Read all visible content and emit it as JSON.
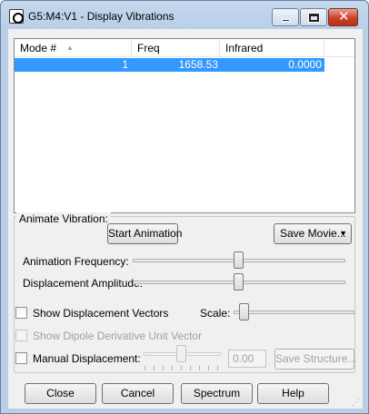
{
  "window": {
    "title": "G5:M4:V1 - Display Vibrations",
    "icons": {
      "app": "document-icon",
      "minimize": "minimize-icon",
      "maximize": "maximize-icon",
      "close": "close-icon"
    }
  },
  "modes_table": {
    "columns": [
      "Mode #",
      "Freq",
      "Infrared"
    ],
    "sort_indicator": "sort-ascending-icon",
    "rows": [
      {
        "mode": "1",
        "freq": "1658.53",
        "infrared": "0.0000",
        "selected": true
      }
    ]
  },
  "animate": {
    "group_label": "Animate Vibration:",
    "start_label": "Start Animation",
    "save_movie_label": "Save Movie...",
    "frequency_label": "Animation Frequency:",
    "amplitude_label": "Displacement Amplitude:"
  },
  "options": {
    "show_vectors_label": "Show Displacement Vectors",
    "show_vectors_checked": false,
    "scale_label": "Scale:",
    "show_dipole_label": "Show Dipole Derivative Unit Vector",
    "show_dipole_checked": false,
    "show_dipole_enabled": false,
    "manual_label": "Manual Displacement:",
    "manual_checked": false,
    "manual_value": "0.00",
    "save_structure_label": "Save Structure..."
  },
  "footer": {
    "close_label": "Close",
    "cancel_label": "Cancel",
    "spectrum_label": "Spectrum",
    "help_label": "Help"
  },
  "colors": {
    "selection": "#3399ff",
    "title_bar": "#b9cfe8",
    "close_button": "#c8422a"
  }
}
